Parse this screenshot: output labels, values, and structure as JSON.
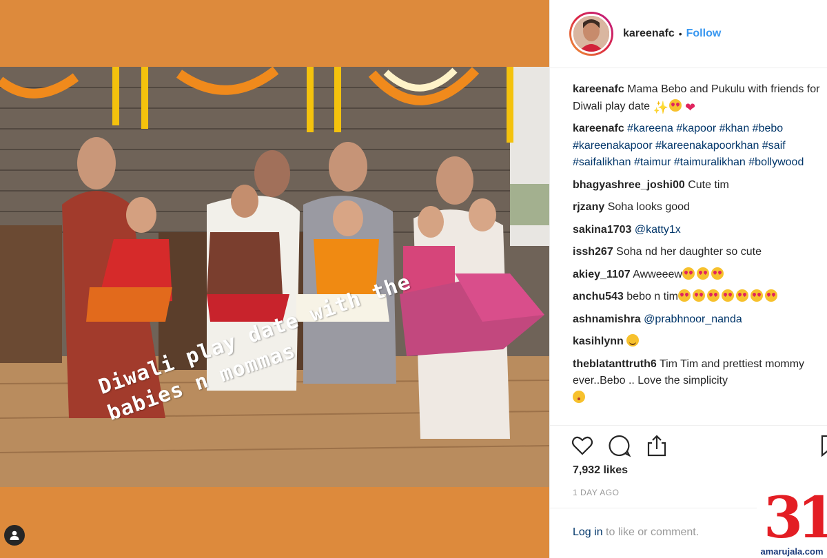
{
  "post": {
    "username": "kareenafc",
    "separator": "•",
    "follow_label": "Follow",
    "overlay_text": [
      "Diwali play date with the",
      "babies n mommas"
    ],
    "likes": "7,932 likes",
    "time_ago": "1 DAY AGO",
    "login_link": "Log in",
    "login_rest": " to like or comment."
  },
  "comments": [
    {
      "user": "kareenafc",
      "text": "Mama Bebo and Pukulu with friends for Diwali play date ",
      "emojis": [
        "star-icon",
        "heart-eyes-icon",
        "heart-icon"
      ]
    },
    {
      "user": "kareenafc",
      "tags": [
        "#kareena",
        "#kapoor",
        "#khan",
        "#bebo",
        "#kareenakapoor",
        "#kareenakapoorkhan",
        "#saif",
        "#saifalikhan",
        "#taimur",
        "#taimuralikhan",
        "#bollywood"
      ]
    },
    {
      "user": "bhagyashree_joshi00",
      "text": "Cute tim"
    },
    {
      "user": "rjzany",
      "text": "Soha looks good"
    },
    {
      "user": "sakina1703",
      "mention": "@katty1x"
    },
    {
      "user": "issh267",
      "text": "Soha nd her daughter so cute"
    },
    {
      "user": "akiey_1107",
      "text": "Awweeew",
      "heart_eyes_count": 3
    },
    {
      "user": "anchu543",
      "text": "bebo n tim",
      "heart_eyes_count": 7
    },
    {
      "user": "ashnamishra",
      "mention": "@prabhnoor_nanda"
    },
    {
      "user": "kasihlynn",
      "emojis": [
        "smile-icon"
      ]
    },
    {
      "user": "theblatanttruth6",
      "text": "Tim Tim and prettiest mommy ever..Bebo .. Love the simplicity",
      "emojis": [
        "kiss-icon"
      ]
    }
  ],
  "actions": [
    "like-heart-icon",
    "comment-bubble-icon",
    "share-icon",
    "bookmark-icon"
  ],
  "watermark": {
    "number": "31",
    "site": "amarujala.com"
  },
  "colors": {
    "border": "#efefef",
    "link": "#003569",
    "follow": "#3897f0",
    "media_bg": "#dd8a3c",
    "watermark_red": "#e31e24"
  }
}
